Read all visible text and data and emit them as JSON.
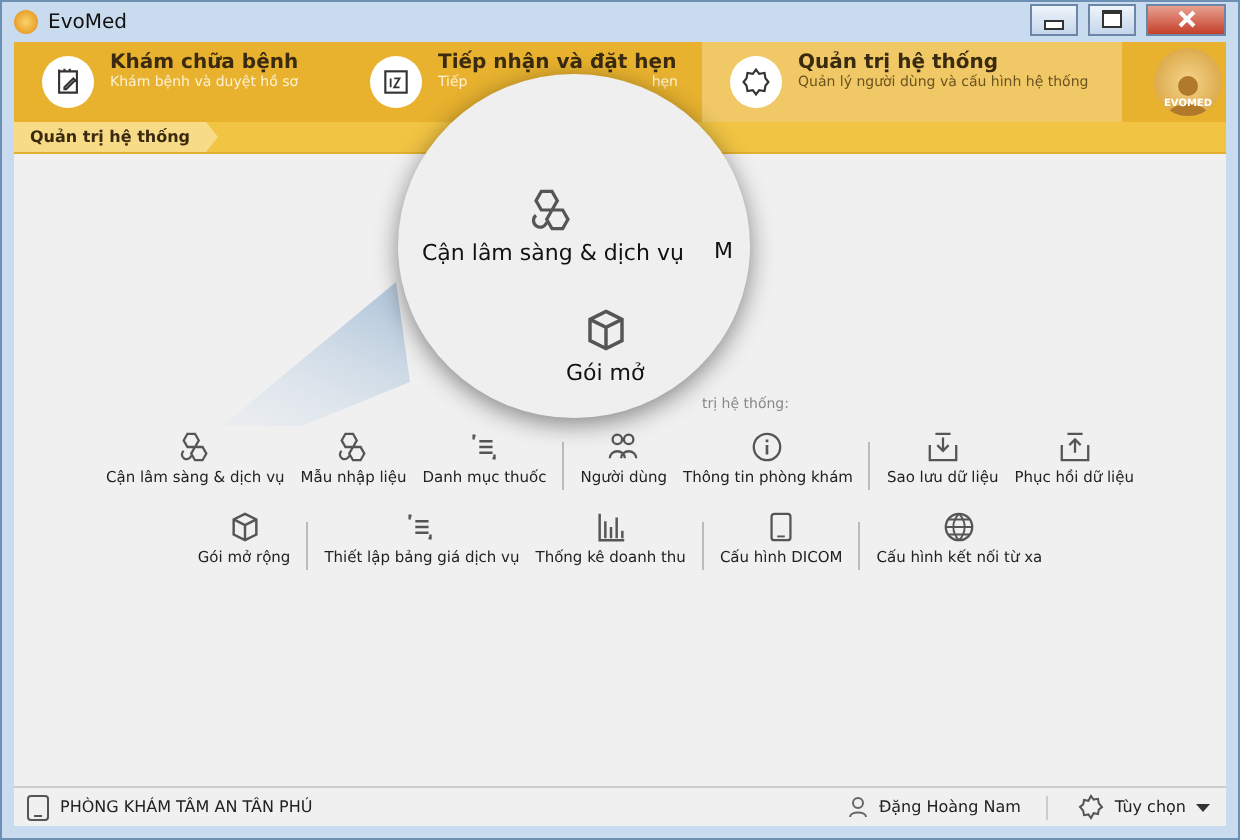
{
  "window": {
    "title": "EvoMed"
  },
  "tabs": [
    {
      "title": "Khám chữa bệnh",
      "subtitle": [
        "Khám bệnh và duyệt hồ sơ"
      ],
      "kind": "note",
      "selected": false
    },
    {
      "title": "Tiếp nhận và đặt hẹn",
      "subtitle": [
        "Tiếp",
        "hẹn"
      ],
      "kind": "calendar",
      "selected": false
    },
    {
      "title": "Quản trị hệ thống",
      "subtitle": [
        "Quản lý người dùng và cấu hình hệ thống"
      ],
      "kind": "gear",
      "selected": true
    }
  ],
  "logo": {
    "text": "EVOMED"
  },
  "breadcrumb": "Quản trị hệ thống",
  "heading": "trị hệ thống:",
  "rows": [
    [
      [
        {
          "label": "Cận lâm sàng & dịch vụ",
          "kind": "hex"
        },
        {
          "label": "Mẫu nhập liệu",
          "kind": "hex"
        },
        {
          "label": "Danh mục thuốc",
          "kind": "list"
        }
      ],
      [
        {
          "label": "Người dùng",
          "kind": "users"
        },
        {
          "label": "Thông tin phòng khám",
          "kind": "info"
        }
      ],
      [
        {
          "label": "Sao lưu dữ liệu",
          "kind": "down"
        },
        {
          "label": "Phục hồi dữ liệu",
          "kind": "up"
        }
      ]
    ],
    [
      [
        {
          "label": "Gói mở rộng",
          "kind": "cube"
        }
      ],
      [
        {
          "label": "Thiết lập bảng giá dịch vụ",
          "kind": "list"
        },
        {
          "label": "Thống kê doanh thu",
          "kind": "chart"
        }
      ],
      [
        {
          "label": "Cấu hình DICOM",
          "kind": "tablet"
        }
      ],
      [
        {
          "label": "Cấu hình kết nối từ xa",
          "kind": "globe"
        }
      ]
    ]
  ],
  "lens": {
    "items": [
      {
        "label": "Cận lâm sàng & dịch vụ",
        "kind": "hex"
      },
      {
        "label": "M",
        "kind": "text"
      },
      {
        "label": "Gói mở",
        "kind": "cube"
      }
    ]
  },
  "status_bar": {
    "clinic": "PHÒNG KHÁM TÂM AN TÂN PHÚ",
    "user": "Đặng Hoàng Nam",
    "options": "Tùy chọn"
  }
}
